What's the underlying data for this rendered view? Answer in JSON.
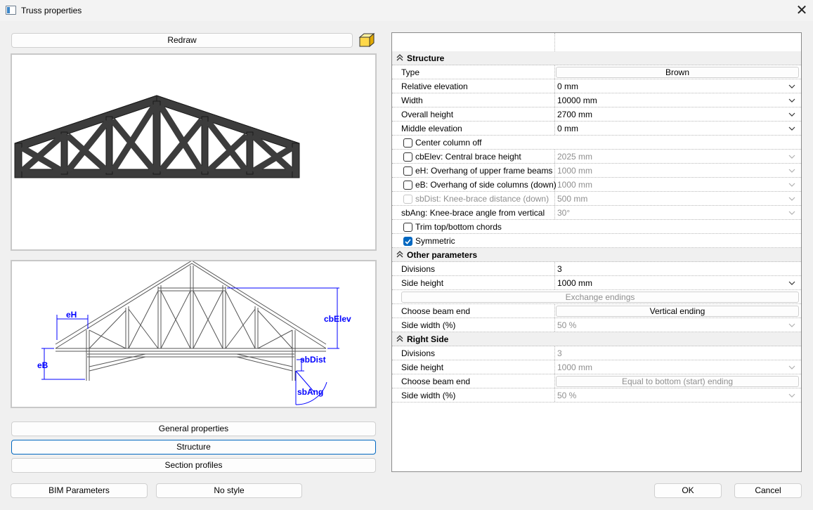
{
  "window": {
    "title": "Truss properties",
    "close_icon": "close-icon"
  },
  "left": {
    "redraw_label": "Redraw",
    "cube_icon": "3d-cube-icon",
    "labels": {
      "eH": "eH",
      "eB": "eB",
      "cbElev": "cbElev",
      "sbDist": "sbDist",
      "sbAng": "sbAng"
    },
    "nav": {
      "general": "General properties",
      "structure": "Structure",
      "section": "Section profiles"
    },
    "bim_label": "BIM Parameters",
    "style_label": "No style"
  },
  "footer": {
    "ok": "OK",
    "cancel": "Cancel"
  },
  "grid": {
    "structure": {
      "header": "Structure",
      "type": {
        "label": "Type",
        "value": "Brown"
      },
      "relative_elevation": {
        "label": "Relative elevation",
        "value": "0 mm"
      },
      "width": {
        "label": "Width",
        "value": "10000 mm"
      },
      "overall_height": {
        "label": "Overall height",
        "value": "2700 mm"
      },
      "middle_elevation": {
        "label": "Middle elevation",
        "value": "0 mm"
      },
      "center_column_off": {
        "label": "Center column off",
        "checked": false
      },
      "cbElev": {
        "label": "cbElev: Central brace height",
        "value": "2025 mm",
        "checked": false
      },
      "eH": {
        "label": "eH: Overhang of upper frame beams",
        "value": "1000 mm",
        "checked": false
      },
      "eB": {
        "label": "eB: Overhang of side columns (down)",
        "value": "1000 mm",
        "checked": false
      },
      "sbDist": {
        "label": "sbDist: Knee-brace distance (down)",
        "value": "500 mm",
        "checked": false
      },
      "sbAng": {
        "label": "sbAng: Knee-brace angle from vertical",
        "value": "30°"
      },
      "trim": {
        "label": "Trim top/bottom chords",
        "checked": false
      },
      "symmetric": {
        "label": "Symmetric",
        "checked": true
      }
    },
    "other": {
      "header": "Other parameters",
      "divisions": {
        "label": "Divisions",
        "value": "3"
      },
      "side_height": {
        "label": "Side height",
        "value": "1000 mm"
      },
      "exchange_label": "Exchange endings",
      "beam_end": {
        "label": "Choose beam end",
        "value": "Vertical ending"
      },
      "side_width": {
        "label": "Side width (%)",
        "value": "50 %"
      }
    },
    "right": {
      "header": "Right Side",
      "divisions": {
        "label": "Divisions",
        "value": "3"
      },
      "side_height": {
        "label": "Side height",
        "value": "1000 mm"
      },
      "beam_end": {
        "label": "Choose beam end",
        "value": "Equal to bottom (start) ending"
      },
      "side_width": {
        "label": "Side width (%)",
        "value": "50 %"
      }
    }
  },
  "colors": {
    "accent": "#0067c0",
    "dimension": "#0000ff",
    "truss": "#3c3c3c"
  }
}
